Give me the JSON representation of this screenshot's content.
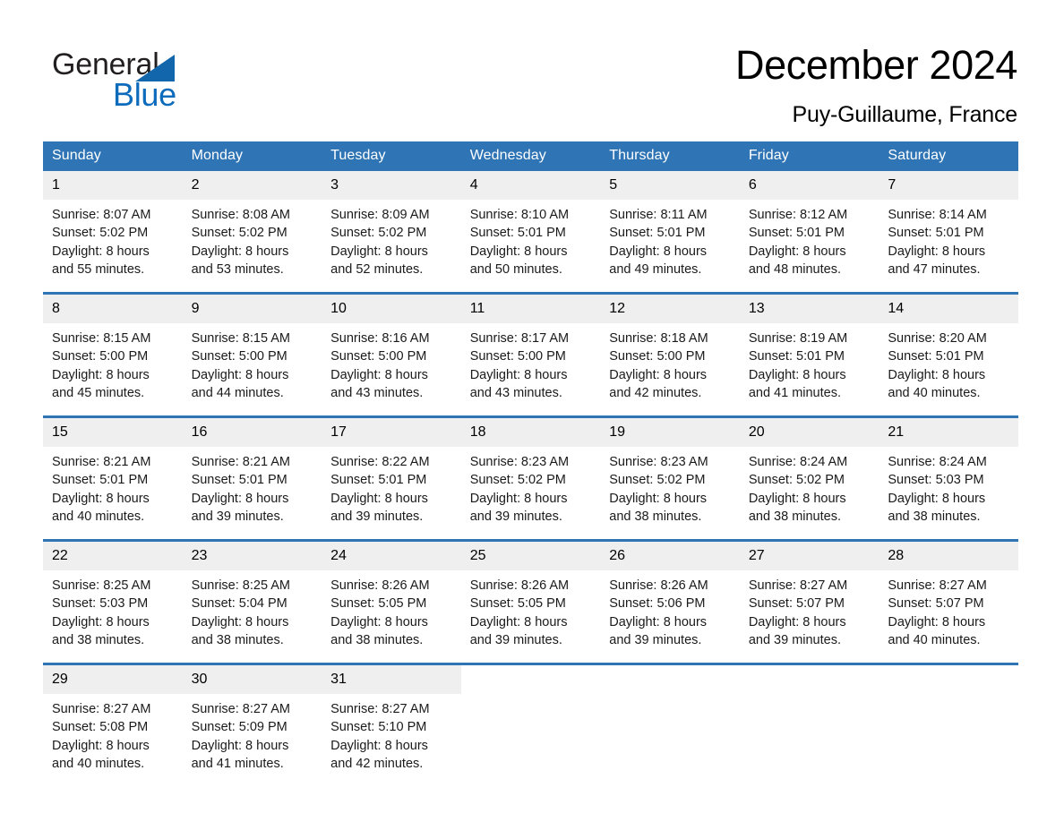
{
  "brand": {
    "name_part1": "General",
    "name_part2": "Blue",
    "triangle_icon": "blue-triangle-logo-mark",
    "accent_color": "#0d6bbc"
  },
  "header": {
    "title": "December 2024",
    "location": "Puy-Guillaume, France"
  },
  "theme": {
    "header_blue": "#2f74b5",
    "row_divider_blue": "#2f74b5",
    "daynum_band": "#efefef"
  },
  "calendar": {
    "weekday_headers": [
      "Sunday",
      "Monday",
      "Tuesday",
      "Wednesday",
      "Thursday",
      "Friday",
      "Saturday"
    ],
    "weeks": [
      [
        {
          "day": "1",
          "sunrise": "Sunrise: 8:07 AM",
          "sunset": "Sunset: 5:02 PM",
          "daylight_line1": "Daylight: 8 hours",
          "daylight_line2": "and 55 minutes."
        },
        {
          "day": "2",
          "sunrise": "Sunrise: 8:08 AM",
          "sunset": "Sunset: 5:02 PM",
          "daylight_line1": "Daylight: 8 hours",
          "daylight_line2": "and 53 minutes."
        },
        {
          "day": "3",
          "sunrise": "Sunrise: 8:09 AM",
          "sunset": "Sunset: 5:02 PM",
          "daylight_line1": "Daylight: 8 hours",
          "daylight_line2": "and 52 minutes."
        },
        {
          "day": "4",
          "sunrise": "Sunrise: 8:10 AM",
          "sunset": "Sunset: 5:01 PM",
          "daylight_line1": "Daylight: 8 hours",
          "daylight_line2": "and 50 minutes."
        },
        {
          "day": "5",
          "sunrise": "Sunrise: 8:11 AM",
          "sunset": "Sunset: 5:01 PM",
          "daylight_line1": "Daylight: 8 hours",
          "daylight_line2": "and 49 minutes."
        },
        {
          "day": "6",
          "sunrise": "Sunrise: 8:12 AM",
          "sunset": "Sunset: 5:01 PM",
          "daylight_line1": "Daylight: 8 hours",
          "daylight_line2": "and 48 minutes."
        },
        {
          "day": "7",
          "sunrise": "Sunrise: 8:14 AM",
          "sunset": "Sunset: 5:01 PM",
          "daylight_line1": "Daylight: 8 hours",
          "daylight_line2": "and 47 minutes."
        }
      ],
      [
        {
          "day": "8",
          "sunrise": "Sunrise: 8:15 AM",
          "sunset": "Sunset: 5:00 PM",
          "daylight_line1": "Daylight: 8 hours",
          "daylight_line2": "and 45 minutes."
        },
        {
          "day": "9",
          "sunrise": "Sunrise: 8:15 AM",
          "sunset": "Sunset: 5:00 PM",
          "daylight_line1": "Daylight: 8 hours",
          "daylight_line2": "and 44 minutes."
        },
        {
          "day": "10",
          "sunrise": "Sunrise: 8:16 AM",
          "sunset": "Sunset: 5:00 PM",
          "daylight_line1": "Daylight: 8 hours",
          "daylight_line2": "and 43 minutes."
        },
        {
          "day": "11",
          "sunrise": "Sunrise: 8:17 AM",
          "sunset": "Sunset: 5:00 PM",
          "daylight_line1": "Daylight: 8 hours",
          "daylight_line2": "and 43 minutes."
        },
        {
          "day": "12",
          "sunrise": "Sunrise: 8:18 AM",
          "sunset": "Sunset: 5:00 PM",
          "daylight_line1": "Daylight: 8 hours",
          "daylight_line2": "and 42 minutes."
        },
        {
          "day": "13",
          "sunrise": "Sunrise: 8:19 AM",
          "sunset": "Sunset: 5:01 PM",
          "daylight_line1": "Daylight: 8 hours",
          "daylight_line2": "and 41 minutes."
        },
        {
          "day": "14",
          "sunrise": "Sunrise: 8:20 AM",
          "sunset": "Sunset: 5:01 PM",
          "daylight_line1": "Daylight: 8 hours",
          "daylight_line2": "and 40 minutes."
        }
      ],
      [
        {
          "day": "15",
          "sunrise": "Sunrise: 8:21 AM",
          "sunset": "Sunset: 5:01 PM",
          "daylight_line1": "Daylight: 8 hours",
          "daylight_line2": "and 40 minutes."
        },
        {
          "day": "16",
          "sunrise": "Sunrise: 8:21 AM",
          "sunset": "Sunset: 5:01 PM",
          "daylight_line1": "Daylight: 8 hours",
          "daylight_line2": "and 39 minutes."
        },
        {
          "day": "17",
          "sunrise": "Sunrise: 8:22 AM",
          "sunset": "Sunset: 5:01 PM",
          "daylight_line1": "Daylight: 8 hours",
          "daylight_line2": "and 39 minutes."
        },
        {
          "day": "18",
          "sunrise": "Sunrise: 8:23 AM",
          "sunset": "Sunset: 5:02 PM",
          "daylight_line1": "Daylight: 8 hours",
          "daylight_line2": "and 39 minutes."
        },
        {
          "day": "19",
          "sunrise": "Sunrise: 8:23 AM",
          "sunset": "Sunset: 5:02 PM",
          "daylight_line1": "Daylight: 8 hours",
          "daylight_line2": "and 38 minutes."
        },
        {
          "day": "20",
          "sunrise": "Sunrise: 8:24 AM",
          "sunset": "Sunset: 5:02 PM",
          "daylight_line1": "Daylight: 8 hours",
          "daylight_line2": "and 38 minutes."
        },
        {
          "day": "21",
          "sunrise": "Sunrise: 8:24 AM",
          "sunset": "Sunset: 5:03 PM",
          "daylight_line1": "Daylight: 8 hours",
          "daylight_line2": "and 38 minutes."
        }
      ],
      [
        {
          "day": "22",
          "sunrise": "Sunrise: 8:25 AM",
          "sunset": "Sunset: 5:03 PM",
          "daylight_line1": "Daylight: 8 hours",
          "daylight_line2": "and 38 minutes."
        },
        {
          "day": "23",
          "sunrise": "Sunrise: 8:25 AM",
          "sunset": "Sunset: 5:04 PM",
          "daylight_line1": "Daylight: 8 hours",
          "daylight_line2": "and 38 minutes."
        },
        {
          "day": "24",
          "sunrise": "Sunrise: 8:26 AM",
          "sunset": "Sunset: 5:05 PM",
          "daylight_line1": "Daylight: 8 hours",
          "daylight_line2": "and 38 minutes."
        },
        {
          "day": "25",
          "sunrise": "Sunrise: 8:26 AM",
          "sunset": "Sunset: 5:05 PM",
          "daylight_line1": "Daylight: 8 hours",
          "daylight_line2": "and 39 minutes."
        },
        {
          "day": "26",
          "sunrise": "Sunrise: 8:26 AM",
          "sunset": "Sunset: 5:06 PM",
          "daylight_line1": "Daylight: 8 hours",
          "daylight_line2": "and 39 minutes."
        },
        {
          "day": "27",
          "sunrise": "Sunrise: 8:27 AM",
          "sunset": "Sunset: 5:07 PM",
          "daylight_line1": "Daylight: 8 hours",
          "daylight_line2": "and 39 minutes."
        },
        {
          "day": "28",
          "sunrise": "Sunrise: 8:27 AM",
          "sunset": "Sunset: 5:07 PM",
          "daylight_line1": "Daylight: 8 hours",
          "daylight_line2": "and 40 minutes."
        }
      ],
      [
        {
          "day": "29",
          "sunrise": "Sunrise: 8:27 AM",
          "sunset": "Sunset: 5:08 PM",
          "daylight_line1": "Daylight: 8 hours",
          "daylight_line2": "and 40 minutes."
        },
        {
          "day": "30",
          "sunrise": "Sunrise: 8:27 AM",
          "sunset": "Sunset: 5:09 PM",
          "daylight_line1": "Daylight: 8 hours",
          "daylight_line2": "and 41 minutes."
        },
        {
          "day": "31",
          "sunrise": "Sunrise: 8:27 AM",
          "sunset": "Sunset: 5:10 PM",
          "daylight_line1": "Daylight: 8 hours",
          "daylight_line2": "and 42 minutes."
        },
        null,
        null,
        null,
        null
      ]
    ]
  }
}
